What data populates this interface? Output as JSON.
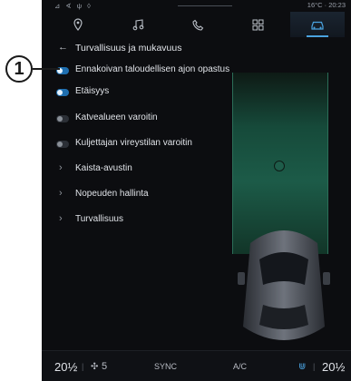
{
  "annotation": {
    "callout_number": "1"
  },
  "statusbar": {
    "left_icons": "⊿ ∢ ψ ◊",
    "temperature_time": "16°C · 20:23"
  },
  "nav": {
    "tabs": [
      {
        "icon": "location-pin-icon"
      },
      {
        "icon": "music-note-icon"
      },
      {
        "icon": "phone-icon"
      },
      {
        "icon": "apps-grid-icon"
      },
      {
        "icon": "car-icon",
        "active": true
      }
    ],
    "accent_color": "#4aa3e0"
  },
  "page": {
    "title": "Turvallisuus ja mukavuus"
  },
  "menu": {
    "items": [
      {
        "label": "Ennakoivan taloudellisen ajon opastus",
        "control": "toggle",
        "state": "on"
      },
      {
        "label": "Etäisyys",
        "control": "toggle",
        "state": "on"
      },
      {
        "label": "Katvealueen varoitin",
        "control": "toggle",
        "state": "off"
      },
      {
        "label": "Kuljettajan vireystilan varoitin",
        "control": "toggle",
        "state": "off"
      },
      {
        "label": "Kaista-avustin",
        "control": "chevron"
      },
      {
        "label": "Nopeuden hallinta",
        "control": "chevron"
      },
      {
        "label": "Turvallisuus",
        "control": "chevron"
      }
    ]
  },
  "bottombar": {
    "temp_left": "20½",
    "fan_level": "5",
    "sync_label": "SYNC",
    "ac_label": "A/C",
    "temp_right": "20½"
  }
}
